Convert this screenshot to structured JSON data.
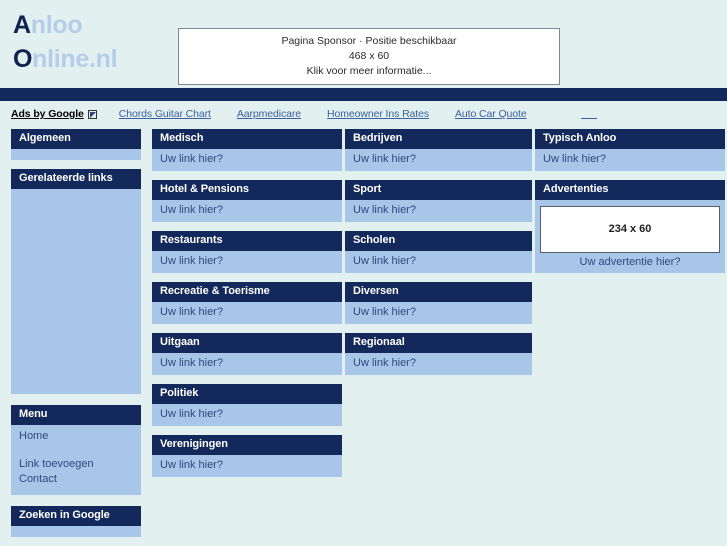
{
  "site": {
    "logo_line1_cap": "A",
    "logo_line1_rest": "nloo",
    "logo_line2_cap": "O",
    "logo_line2_rest": "nline.nl",
    "brand_dark": "#0f2350",
    "brand_light": "#b3cdea",
    "page_bg": "#e3f0f0",
    "panel_head_bg": "#13295c",
    "panel_body_bg": "#a8c6e8"
  },
  "sponsor": {
    "line1": "Pagina Sponsor · Positie beschikbaar",
    "line2": "468 x 60",
    "line3": "Klik voor meer informatie..."
  },
  "ads_bar": {
    "label": "Ads by Google",
    "icon": "external-link-icon",
    "links": [
      "Chords Guitar Chart",
      "Aarpmedicare",
      "Homeowner Ins Rates",
      "Auto Car Quote"
    ],
    "trailing_blank_link": ""
  },
  "sidebar": {
    "panels": [
      {
        "title": "Algemeen",
        "body": ""
      },
      {
        "title": "Gerelateerde links",
        "body": ""
      }
    ],
    "menu": {
      "title": "Menu",
      "items": [
        "Home",
        "",
        "Link toevoegen",
        "Contact"
      ]
    },
    "search": {
      "title": "Zoeken in Google"
    }
  },
  "columns": {
    "one": [
      {
        "title": "Medisch",
        "link": "Uw link hier?"
      },
      {
        "title": "Hotel & Pensions",
        "link": "Uw link hier?"
      },
      {
        "title": "Restaurants",
        "link": "Uw link hier?"
      },
      {
        "title": "Recreatie & Toerisme",
        "link": "Uw link hier?"
      },
      {
        "title": "Uitgaan",
        "link": "Uw link hier?"
      },
      {
        "title": "Politiek",
        "link": "Uw link hier?"
      },
      {
        "title": "Verenigingen",
        "link": "Uw link hier?"
      }
    ],
    "two": [
      {
        "title": "Bedrijven",
        "link": "Uw link hier?"
      },
      {
        "title": "Sport",
        "link": "Uw link hier?"
      },
      {
        "title": "Scholen",
        "link": "Uw link hier?"
      },
      {
        "title": "Diversen",
        "link": "Uw link hier?"
      },
      {
        "title": "Regionaal",
        "link": "Uw link hier?"
      }
    ],
    "three": {
      "typisch": {
        "title": "Typisch Anloo",
        "link": "Uw link hier?"
      },
      "adverts": {
        "title": "Advertenties",
        "slot_size": "234 x 60",
        "caption": "Uw advertentie hier?"
      }
    }
  }
}
